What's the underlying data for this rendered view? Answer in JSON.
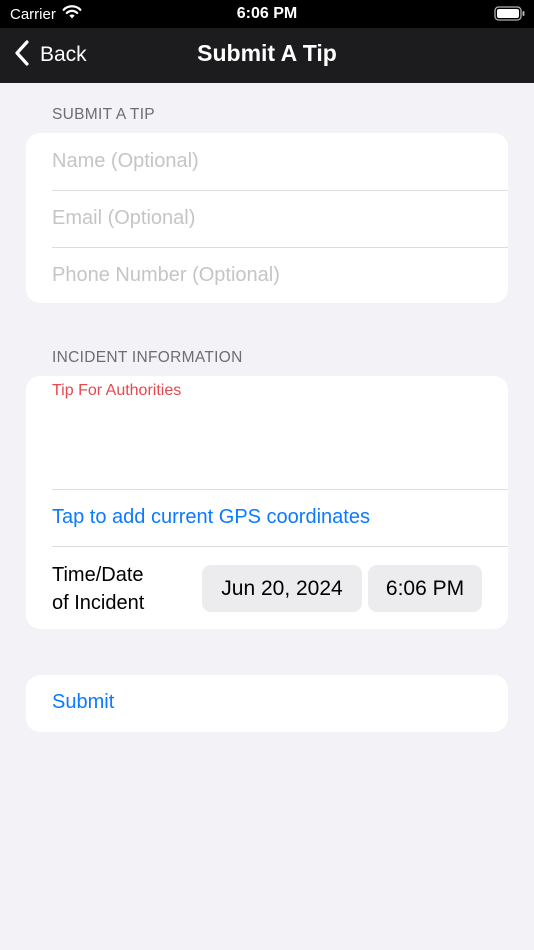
{
  "status_bar": {
    "carrier": "Carrier",
    "time": "6:06 PM"
  },
  "nav": {
    "back_label": "Back",
    "title": "Submit A Tip"
  },
  "tip_section": {
    "header": "SUBMIT A TIP",
    "name_placeholder": "Name (Optional)",
    "email_placeholder": "Email (Optional)",
    "phone_placeholder": "Phone Number (Optional)"
  },
  "incident_section": {
    "header": "INCIDENT INFORMATION",
    "tip_label": "Tip For Authorities",
    "tip_label_color": "#e5484d",
    "gps_label": "Tap to add current GPS coordinates",
    "datetime_label_line1": "Time/Date",
    "datetime_label_line2": "of Incident",
    "date_value": "Jun 20, 2024",
    "time_value": "6:06 PM"
  },
  "submit": {
    "label": "Submit"
  },
  "colors": {
    "accent": "#0a7aff",
    "background": "#f2f2f7",
    "nav_background": "#1c1c1e"
  },
  "icons": [
    "wifi-icon",
    "battery-icon",
    "chevron-left-icon"
  ]
}
